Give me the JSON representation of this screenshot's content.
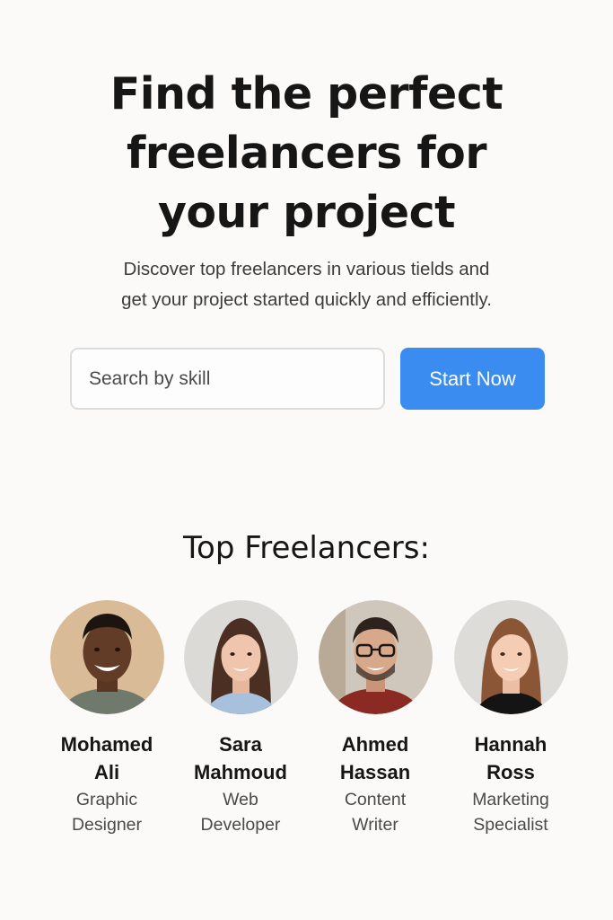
{
  "hero": {
    "title_lines": [
      "Find the perfect",
      "freelancers for",
      "your project"
    ],
    "subtitle_lines": [
      "Discover top freelancers in various tields and",
      "get your project started quickly and efficiently."
    ]
  },
  "search": {
    "placeholder": "Search by skill",
    "value": "",
    "button_label": "Start Now",
    "button_color": "#3b8cf0"
  },
  "top_freelancers": {
    "title": "Top Freelancers:",
    "items": [
      {
        "name_lines": [
          "Mohamed",
          "Ali"
        ],
        "role_lines": [
          "Graphic",
          "Designer"
        ],
        "avatar": "man-smiling-avatar"
      },
      {
        "name_lines": [
          "Sara",
          "Mahmoud"
        ],
        "role_lines": [
          "Web",
          "Developer"
        ],
        "avatar": "woman-dark-hair-avatar"
      },
      {
        "name_lines": [
          "Ahmed",
          "Hassan"
        ],
        "role_lines": [
          "Content",
          "Writer"
        ],
        "avatar": "man-glasses-avatar"
      },
      {
        "name_lines": [
          "Hannah",
          "Ross"
        ],
        "role_lines": [
          "Marketing",
          "Specialist"
        ],
        "avatar": "woman-auburn-hair-avatar"
      }
    ]
  }
}
